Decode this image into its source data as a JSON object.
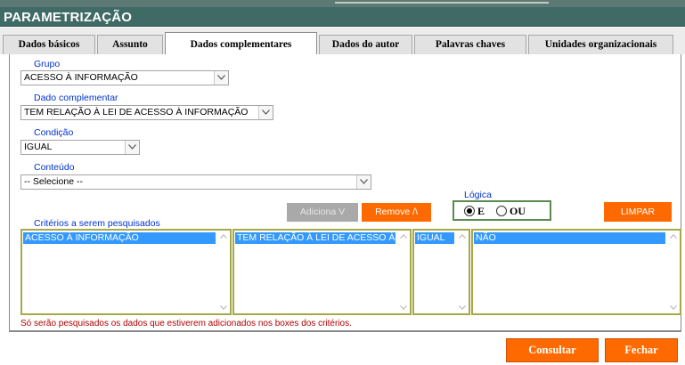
{
  "header": {
    "title": "PARAMETRIZAÇÃO"
  },
  "tabs": [
    {
      "label": "Dados básicos"
    },
    {
      "label": "Assunto"
    },
    {
      "label": "Dados complementares",
      "active": true
    },
    {
      "label": "Dados do autor"
    },
    {
      "label": "Palavras chaves"
    },
    {
      "label": "Unidades organizacionais"
    }
  ],
  "form": {
    "grupo": {
      "label": "Grupo",
      "value": "ACESSO À INFORMAÇÃO"
    },
    "dado_complementar": {
      "label": "Dado complementar",
      "value": "TEM RELAÇÃO À LEI DE ACESSO À INFORMAÇÃO"
    },
    "condicao": {
      "label": "Condição",
      "value": "IGUAL"
    },
    "conteudo": {
      "label": "Conteúdo",
      "value": "-- Selecione --"
    }
  },
  "actions": {
    "adiciona": "Adiciona V",
    "remove": "Remove /\\",
    "limpar": "LIMPAR"
  },
  "logica": {
    "label": "Lógica",
    "options": [
      {
        "label": "E",
        "selected": true
      },
      {
        "label": "OU",
        "selected": false
      }
    ]
  },
  "criterios": {
    "label": "Critérios a serem pesquisados",
    "lists": [
      {
        "items": [
          "ACESSO À INFORMAÇÃO"
        ]
      },
      {
        "items": [
          "TEM RELAÇÃO À LEI DE ACESSO À INFORMAÇÃO"
        ]
      },
      {
        "items": [
          "IGUAL"
        ]
      },
      {
        "items": [
          "NÃO"
        ]
      }
    ],
    "note": "Só serão pesquisados os dados que estiverem adicionados nos boxes dos critérios."
  },
  "footer": {
    "consultar": "Consultar",
    "fechar": "Fechar"
  },
  "colors": {
    "header_bg": "#3f6a66",
    "label_blue": "#0033cc",
    "button_orange": "#ff6a00",
    "selection_blue": "#3399ff",
    "note_red": "#b00000",
    "list_border": "#a6a94a"
  },
  "icons": {
    "dropdown": "chevron-down-icon",
    "scroll_up": "chevron-up-icon",
    "scroll_down": "chevron-down-icon"
  }
}
